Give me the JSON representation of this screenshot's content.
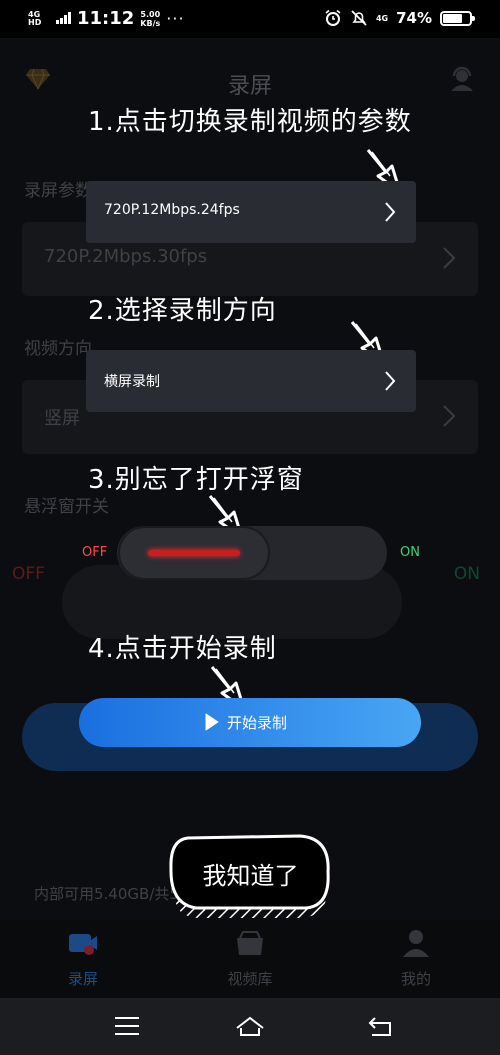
{
  "status_bar": {
    "network": "4G HD",
    "time": "11:12",
    "speed_value": "5.00",
    "speed_unit": "KB/s",
    "more": "···",
    "mobile": "4G",
    "battery_pct": "74%",
    "battery_level": 0.74
  },
  "header": {
    "title": "录屏"
  },
  "settings": {
    "resolution_label": "录屏参数",
    "resolution_value": "720P.2Mbps.30fps",
    "orientation_label": "视频方向",
    "orientation_value": "竖屏",
    "float_label": "悬浮窗开关",
    "off": "OFF",
    "on": "ON"
  },
  "storage": "内部可用5.40GB/共54.42GB",
  "tabs": [
    {
      "label": "录屏",
      "icon": "record-icon"
    },
    {
      "label": "视频库",
      "icon": "folder-icon"
    },
    {
      "label": "我的",
      "icon": "user-icon"
    }
  ],
  "guide": {
    "step1": "1.点击切换录制视频的参数",
    "step1_card": "720P.12Mbps.24fps",
    "step2": "2.选择录制方向",
    "step2_card": "横屏录制",
    "step3": "3.别忘了打开浮窗",
    "step3_off": "OFF",
    "step3_on": "ON",
    "step4": "4.点击开始录制",
    "start_button": "开始录制",
    "got_it": "我知道了"
  },
  "colors": {
    "accent": "#1a6fe0",
    "off_red": "#ff4a4a",
    "on_green": "#3fd27a"
  }
}
